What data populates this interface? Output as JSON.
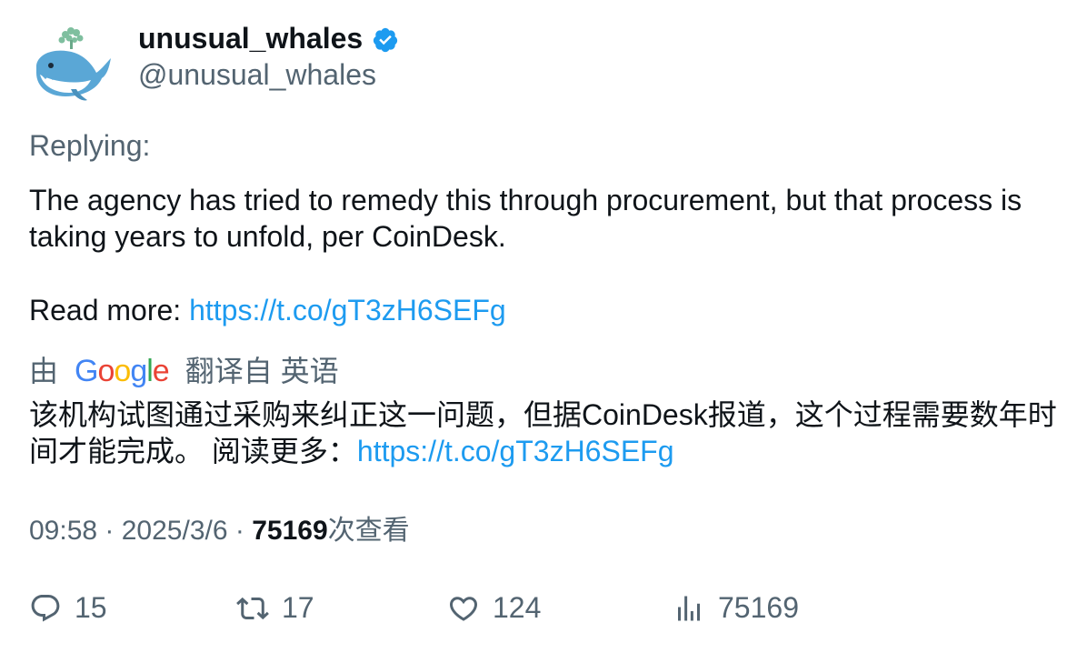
{
  "author": {
    "display_name": "unusual_whales",
    "handle": "@unusual_whales",
    "verified": true,
    "avatar_icon": "whale-avatar-icon",
    "verified_color": "#1d9bf0"
  },
  "replying_label": "Replying:",
  "tweet": {
    "text_line": "The agency has tried to remedy this through procurement, but that process is taking years to unfold, per CoinDesk.",
    "read_more_label": "Read more: ",
    "link": "https://t.co/gT3zH6SEFg"
  },
  "translation": {
    "prefix": "由",
    "provider": "Google",
    "suffix": "翻译自 英语",
    "text": "该机构试图通过采购来纠正这一问题，但据CoinDesk报道，这个过程需要数年时间才能完成。 阅读更多：",
    "link": "https://t.co/gT3zH6SEFg"
  },
  "meta": {
    "time": "09:58",
    "date": "2025/3/6",
    "separator": " · ",
    "views_count": "75169",
    "views_label": "次查看"
  },
  "actions": {
    "replies": "15",
    "retweets": "17",
    "likes": "124",
    "views": "75169"
  },
  "colors": {
    "link": "#1d9bf0",
    "secondary_text": "#536471",
    "primary_text": "#0f1419"
  }
}
